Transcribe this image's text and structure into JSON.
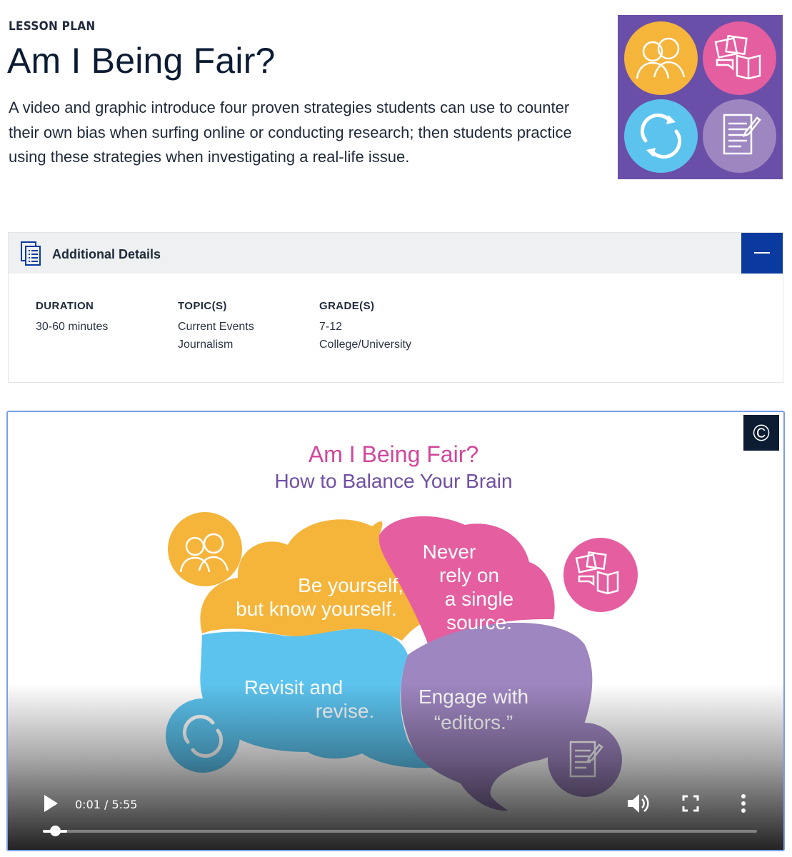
{
  "header": {
    "eyebrow": "LESSON PLAN",
    "title": "Am I Being Fair?",
    "description": "A video and graphic introduce four proven strategies students can use to counter their own bias when surfing online or conducting research; then students practice using these strategies when investigating a real-life issue."
  },
  "details": {
    "title": "Additional Details",
    "columns": [
      {
        "label": "DURATION",
        "values": [
          "30-60 minutes"
        ]
      },
      {
        "label": "TOPIC(S)",
        "values": [
          "Current Events",
          "Journalism"
        ]
      },
      {
        "label": "GRADE(S)",
        "values": [
          "7-12",
          "College/University"
        ]
      }
    ]
  },
  "video": {
    "slide_title": "Am I Being Fair?",
    "slide_subtitle": "How to Balance Your Brain",
    "bubbles": {
      "yellow": [
        "Be yourself,",
        "but know yourself."
      ],
      "pink": [
        "Never",
        "rely on",
        "a single",
        "source."
      ],
      "blue": [
        "Revisit and",
        "revise."
      ],
      "purple": [
        "Engage with",
        "“editors.”"
      ]
    },
    "cc_symbol": "©",
    "current_time": "0:01",
    "duration": "5:55",
    "time_display": "0:01 / 5:55",
    "progress": 0.01
  },
  "colors": {
    "navy": "#0b1c33",
    "accent_blue": "#0b3a9e",
    "yellow": "#f5b43a",
    "pink": "#e45ea0",
    "blue": "#5cc3ee",
    "purple": "#9e86c0",
    "hero_bg": "#6a4fa8"
  },
  "icons": {
    "hero": [
      "people-icon",
      "sources-icon",
      "revise-icon",
      "document-icon"
    ],
    "controls": [
      "play-icon",
      "volume-icon",
      "fullscreen-icon",
      "more-icon"
    ]
  }
}
